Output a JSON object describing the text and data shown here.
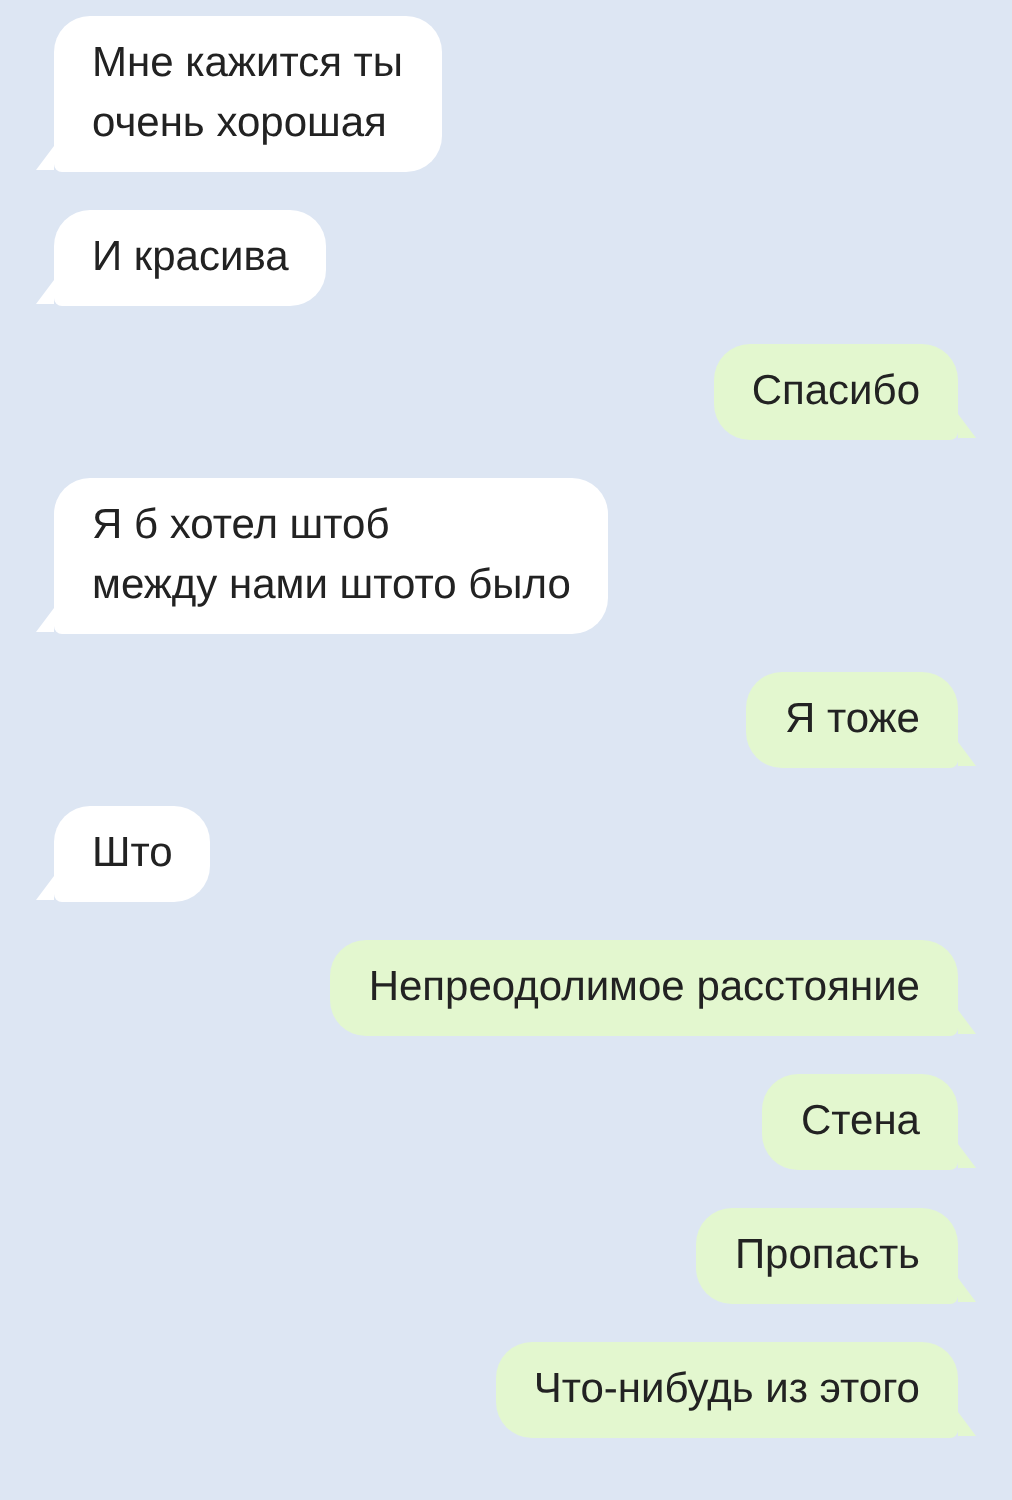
{
  "messages": [
    {
      "kind": "incoming",
      "text": "Мне кажится ты\nочень хорошая"
    },
    {
      "kind": "incoming",
      "text": "И красива"
    },
    {
      "kind": "outgoing",
      "text": "Спасибо"
    },
    {
      "kind": "incoming",
      "text": "Я б хотел штоб\nмежду нами штото было"
    },
    {
      "kind": "outgoing",
      "text": "Я тоже"
    },
    {
      "kind": "incoming",
      "text": "Што"
    },
    {
      "kind": "outgoing",
      "text": "Непреодолимое расстояние"
    },
    {
      "kind": "outgoing",
      "text": "Стена"
    },
    {
      "kind": "outgoing",
      "text": "Пропасть"
    },
    {
      "kind": "outgoing",
      "text": "Что-нибудь из этого"
    }
  ]
}
